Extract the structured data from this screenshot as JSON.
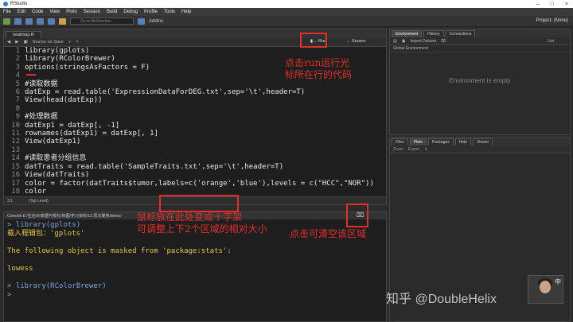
{
  "window": {
    "title": "RStudio",
    "project": "Project: (None)"
  },
  "menu": [
    "File",
    "Edit",
    "Code",
    "View",
    "Plots",
    "Session",
    "Build",
    "Debug",
    "Profile",
    "Tools",
    "Help"
  ],
  "toolbar": {
    "goto_placeholder": "Go to file/function",
    "addins": "Addins"
  },
  "editor": {
    "tab": "heatmap.R",
    "source_on_save": "Source on Save",
    "run_label": "Run",
    "source_label": "Source",
    "lines": [
      {
        "n": "1",
        "t": "library(gplots)"
      },
      {
        "n": "2",
        "t": "library(RColorBrewer)"
      },
      {
        "n": "3",
        "t": "options(stringsAsFactors = F)"
      },
      {
        "n": "4",
        "t": ""
      },
      {
        "n": "5",
        "t": "#读取数据"
      },
      {
        "n": "6",
        "t": "datExp = read.table('ExpressionDataForDEG.txt',sep='\\t',header=T)"
      },
      {
        "n": "7",
        "t": "View(head(datExp))"
      },
      {
        "n": "8",
        "t": ""
      },
      {
        "n": "9",
        "t": "#处理数据"
      },
      {
        "n": "10",
        "t": "datExp1 = datExp[, -1]"
      },
      {
        "n": "11",
        "t": "rownames(datExp1) = datExp[, 1]"
      },
      {
        "n": "12",
        "t": "View(datExp1)"
      },
      {
        "n": "13",
        "t": ""
      },
      {
        "n": "14",
        "t": "#读取患者分组信息"
      },
      {
        "n": "15",
        "t": "datTraits = read.table('SampleTraits.txt',sep='\\t',header=T)"
      },
      {
        "n": "16",
        "t": "View(datTraits)"
      },
      {
        "n": "17",
        "t": "color = factor(datTraits$tumor,labels=c('orange','blue'),levels = c(\"HCC\",\"NOR\"))"
      },
      {
        "n": "18",
        "t": "color"
      }
    ],
    "status_pos": "3:1",
    "status_scope": "(Top Level)"
  },
  "console": {
    "header": "Console E:/生信/R/数据可视化/热图/学习资料/13.层次聚类/demo/",
    "lines": [
      {
        "cls": "c-prompt",
        "t": "> library(gplots)"
      },
      {
        "cls": "c-msg",
        "t": "载入程辑包：'gplots'"
      },
      {
        "cls": "c-gray",
        "t": ""
      },
      {
        "cls": "c-msg",
        "t": "The following object is masked from 'package:stats':"
      },
      {
        "cls": "c-gray",
        "t": ""
      },
      {
        "cls": "c-msg",
        "t": "    lowess"
      },
      {
        "cls": "c-gray",
        "t": ""
      },
      {
        "cls": "c-prompt",
        "t": "> library(RColorBrewer)"
      },
      {
        "cls": "c-prompt",
        "t": ">"
      }
    ]
  },
  "env": {
    "tabs": [
      "Environment",
      "History",
      "Connections"
    ],
    "import": "Import Dataset",
    "scope": "Global Environment",
    "list": "List",
    "empty": "Environment is empty"
  },
  "files": {
    "tabs": [
      "Files",
      "Plots",
      "Packages",
      "Help",
      "Viewer"
    ],
    "zoom": "Zoom",
    "export": "Export"
  },
  "annotations": {
    "run": [
      "点击run运行光",
      "标所在行的代码"
    ],
    "splitter": [
      "鼠标放在此处变成十字架",
      "可调整上下2个区域的相对大小"
    ],
    "clear": "点击可清空该区域"
  },
  "watermark": "知乎 @DoubleHelix",
  "avatar_label": "中"
}
